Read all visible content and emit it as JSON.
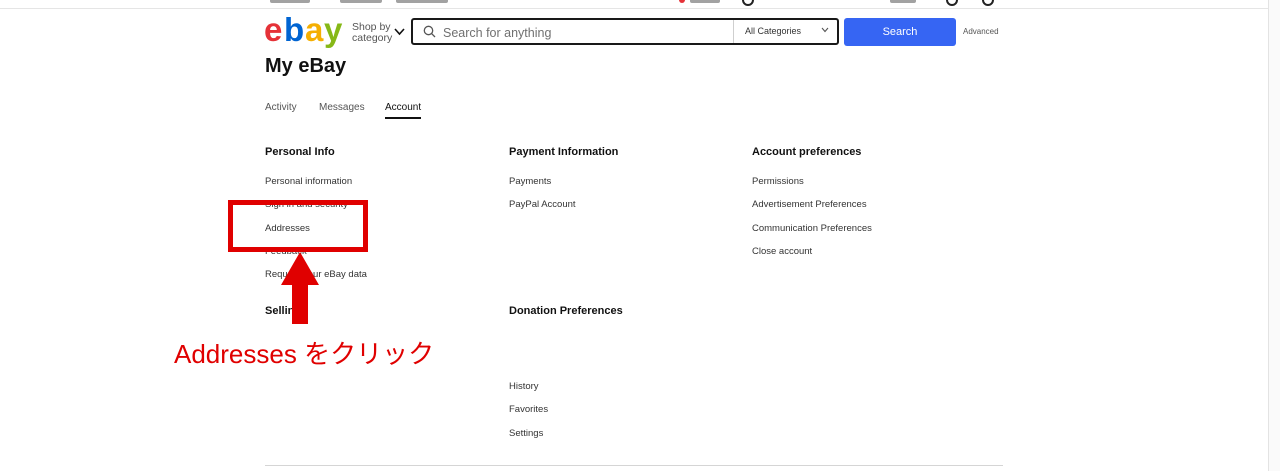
{
  "header": {
    "logo_letters": [
      "e",
      "b",
      "a",
      "y"
    ],
    "logo_colors": [
      "#e53238",
      "#0064d2",
      "#f5af02",
      "#86b817"
    ],
    "shop_by_line1": "Shop by",
    "shop_by_line2": "category",
    "search_placeholder": "Search for anything",
    "category_select": "All Categories",
    "search_button": "Search",
    "advanced_link": "Advanced",
    "accent_color": "#3665f3"
  },
  "page": {
    "title": "My eBay"
  },
  "tabs": [
    {
      "label": "Activity",
      "active": false
    },
    {
      "label": "Messages",
      "active": false
    },
    {
      "label": "Account",
      "active": true
    }
  ],
  "sections": {
    "personal_info": {
      "heading": "Personal Info",
      "links": [
        "Personal information",
        "Sign in and security",
        "Addresses",
        "Feedback",
        "Request your eBay data"
      ]
    },
    "payment": {
      "heading": "Payment Information",
      "links": [
        "Payments",
        "PayPal Account"
      ]
    },
    "account_prefs": {
      "heading": "Account preferences",
      "links": [
        "Permissions",
        "Advertisement Preferences",
        "Communication Preferences",
        "Close account"
      ]
    },
    "selling": {
      "heading": "Selling"
    },
    "donation": {
      "heading": "Donation Preferences",
      "links": [
        "History",
        "Favorites",
        "Settings"
      ]
    }
  },
  "annotation": {
    "text": "Addresses をクリック",
    "color": "#e00000"
  }
}
